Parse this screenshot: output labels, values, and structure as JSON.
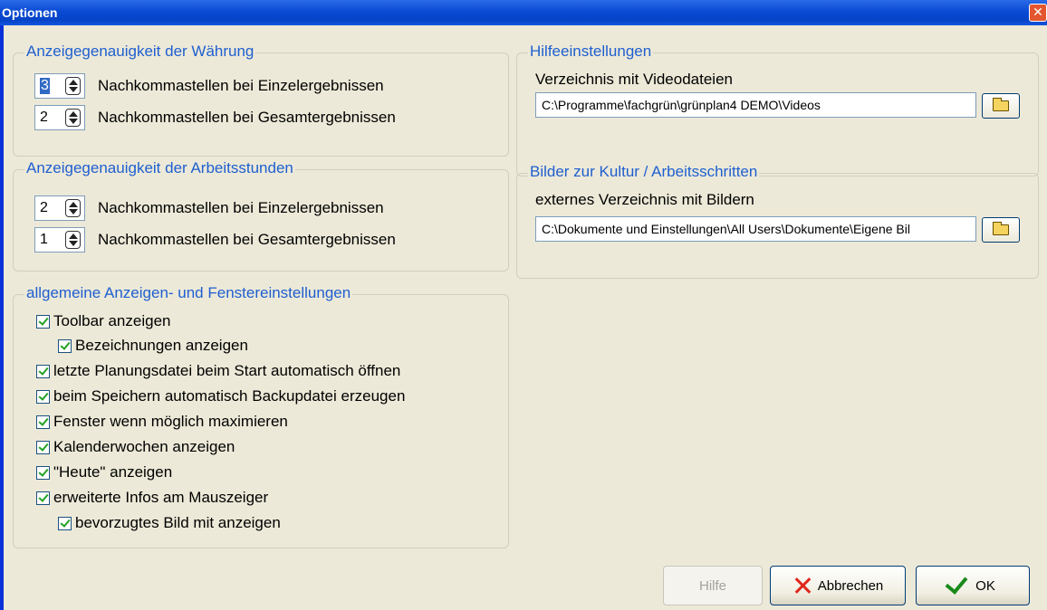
{
  "window": {
    "title": "Optionen",
    "close_glyph": "✕",
    "accent_color": "#0a4ad4",
    "group_label_color": "#1f5fd0"
  },
  "currency": {
    "label": "Anzeigegenauigkeit der Währung",
    "rows": [
      {
        "value": "3",
        "label": "Nachkommastellen bei Einzelergebnissen"
      },
      {
        "value": "2",
        "label": "Nachkommastellen bei Gesamtergebnissen"
      }
    ]
  },
  "hours": {
    "label": "Anzeigegenauigkeit der Arbeitsstunden",
    "rows": [
      {
        "value": "2",
        "label": "Nachkommastellen bei Einzelergebnissen"
      },
      {
        "value": "1",
        "label": "Nachkommastellen bei Gesamtergebnissen"
      }
    ]
  },
  "general": {
    "label": "allgemeine Anzeigen- und Fenstereinstellungen",
    "checkboxes": [
      {
        "label": "Toolbar anzeigen",
        "checked": true
      },
      {
        "label": "Bezeichnungen anzeigen",
        "checked": true
      },
      {
        "label": "letzte Planungsdatei beim Start automatisch öffnen",
        "checked": true
      },
      {
        "label": "beim Speichern automatisch Backupdatei erzeugen",
        "checked": true
      },
      {
        "label": "Fenster wenn möglich maximieren",
        "checked": true
      },
      {
        "label": "Kalenderwochen anzeigen",
        "checked": true
      },
      {
        "label": "\"Heute\" anzeigen",
        "checked": true
      },
      {
        "label": "erweiterte Infos am Mauszeiger",
        "checked": true
      },
      {
        "label": "bevorzugtes Bild mit anzeigen",
        "checked": true
      }
    ]
  },
  "help": {
    "label": "Hilfeeinstellungen",
    "field_label": "Verzeichnis mit Videodateien",
    "path": "C:\\Programme\\fachgrün\\grünplan4 DEMO\\Videos"
  },
  "images": {
    "label": "Bilder zur Kultur / Arbeitsschritten",
    "field_label": "externes Verzeichnis mit Bildern",
    "path": "C:\\Dokumente und Einstellungen\\All Users\\Dokumente\\Eigene Bil"
  },
  "buttons": {
    "help": "Hilfe",
    "cancel": "Abbrechen",
    "ok": "OK"
  }
}
